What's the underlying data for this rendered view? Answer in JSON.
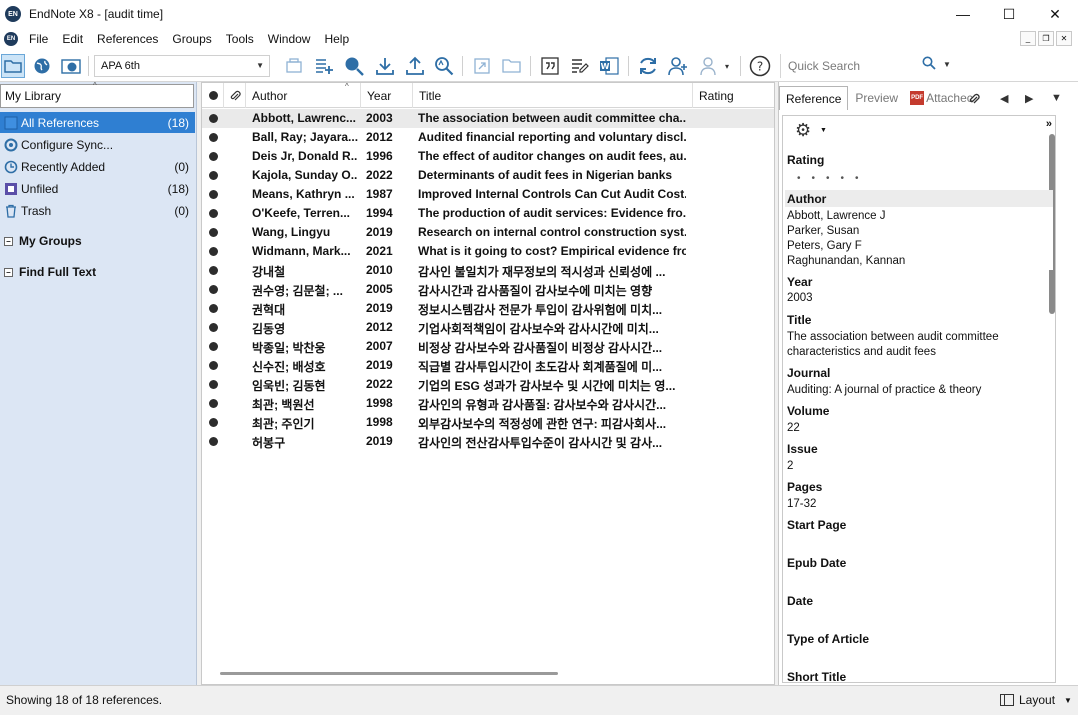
{
  "window": {
    "title": "EndNote X8 - [audit time]",
    "app_icon_text": "EN",
    "controls": {
      "minimize": "—",
      "maximize": "☐",
      "close": "✕"
    }
  },
  "menu": {
    "items": [
      "File",
      "Edit",
      "References",
      "Groups",
      "Tools",
      "Window",
      "Help"
    ]
  },
  "toolbar": {
    "style": "APA 6th",
    "quick_search_placeholder": "Quick Search"
  },
  "library": {
    "header": "My Library",
    "groups": [
      {
        "label": "All References",
        "count": "(18)",
        "icon": "book-icon"
      },
      {
        "label": "Configure Sync...",
        "count": "",
        "icon": "sync-icon"
      },
      {
        "label": "Recently Added",
        "count": "(0)",
        "icon": "clock-icon"
      },
      {
        "label": "Unfiled",
        "count": "(18)",
        "icon": "unfiled-icon"
      },
      {
        "label": "Trash",
        "count": "(0)",
        "icon": "trash-icon"
      }
    ],
    "my_groups": "My Groups",
    "find_full_text": "Find Full Text"
  },
  "list": {
    "columns": {
      "author": "Author",
      "year": "Year",
      "title": "Title",
      "rating": "Rating"
    },
    "rows": [
      {
        "author": "Abbott, Lawrenc...",
        "year": "2003",
        "title": "The association between audit committee cha...",
        "bold": true
      },
      {
        "author": "Ball, Ray; Jayara...",
        "year": "2012",
        "title": "Audited financial reporting and voluntary discl...",
        "bold": true
      },
      {
        "author": "Deis Jr, Donald R...",
        "year": "1996",
        "title": "The effect of auditor changes on audit fees, au...",
        "bold": true
      },
      {
        "author": "Kajola, Sunday O...",
        "year": "2022",
        "title": "Determinants of audit fees in Nigerian banks",
        "bold": true
      },
      {
        "author": "Means, Kathryn ...",
        "year": "1987",
        "title": "Improved Internal Controls Can Cut Audit Cost...",
        "bold": true
      },
      {
        "author": "O'Keefe, Terren...",
        "year": "1994",
        "title": "The production of audit services: Evidence fro...",
        "bold": true
      },
      {
        "author": "Wang, Lingyu",
        "year": "2019",
        "title": "Research on internal control construction syst...",
        "bold": true
      },
      {
        "author": "Widmann, Mark...",
        "year": "2021",
        "title": "What is it going to cost? Empirical evidence fro...",
        "bold": true
      },
      {
        "author": "강내철",
        "year": "2010",
        "title": "감사인 불일치가 재무정보의 적시성과 신뢰성에 ...",
        "bold": true
      },
      {
        "author": "권수영; 김문철; ...",
        "year": "2005",
        "title": "감사시간과 감사품질이 감사보수에 미치는 영향",
        "bold": true
      },
      {
        "author": "권혁대",
        "year": "2019",
        "title": "정보시스템감사 전문가 투입이 감사위험에 미치...",
        "bold": true
      },
      {
        "author": "김동영",
        "year": "2012",
        "title": "기업사회적책임이 감사보수와 감사시간에 미치...",
        "bold": true
      },
      {
        "author": "박종일; 박찬웅",
        "year": "2007",
        "title": "비정상 감사보수와 감사품질이 비정상 감사시간...",
        "bold": true
      },
      {
        "author": "신수진; 배성호",
        "year": "2019",
        "title": "직급별 감사투입시간이 초도감사 회계품질에 미...",
        "bold": true
      },
      {
        "author": "임욱빈; 김동현",
        "year": "2022",
        "title": "기업의 ESG 성과가 감사보수 및 시간에 미치는 영...",
        "bold": true
      },
      {
        "author": "최관; 백원선",
        "year": "1998",
        "title": "감사인의 유형과 감사품질: 감사보수와 감사시간...",
        "bold": true
      },
      {
        "author": "최관; 주인기",
        "year": "1998",
        "title": "외부감사보수의 적정성에 관한 연구: 피감사회사...",
        "bold": true
      },
      {
        "author": "허봉구",
        "year": "2019",
        "title": "감사인의 전산감사투입수준이 감사시간 및 감사...",
        "bold": true
      }
    ]
  },
  "detail": {
    "tabs": {
      "reference": "Reference",
      "preview": "Preview",
      "attached": "Attachec",
      "pdf_badge": "PDF"
    },
    "fields": {
      "rating_label": "Rating",
      "author_label": "Author",
      "authors": [
        "Abbott, Lawrence J",
        "Parker, Susan",
        "Peters, Gary F",
        "Raghunandan, Kannan"
      ],
      "year_label": "Year",
      "year": "2003",
      "title_label": "Title",
      "title_line1": "The association between audit committee",
      "title_line2": "characteristics and audit fees",
      "journal_label": "Journal",
      "journal": "Auditing: A journal of practice & theory",
      "volume_label": "Volume",
      "volume": "22",
      "issue_label": "Issue",
      "issue": "2",
      "pages_label": "Pages",
      "pages": "17-32",
      "start_page_label": "Start Page",
      "epub_date_label": "Epub Date",
      "date_label": "Date",
      "type_label": "Type of Article",
      "short_title_label": "Short Title"
    }
  },
  "status": {
    "text": "Showing 18 of 18 references.",
    "layout": "Layout"
  }
}
